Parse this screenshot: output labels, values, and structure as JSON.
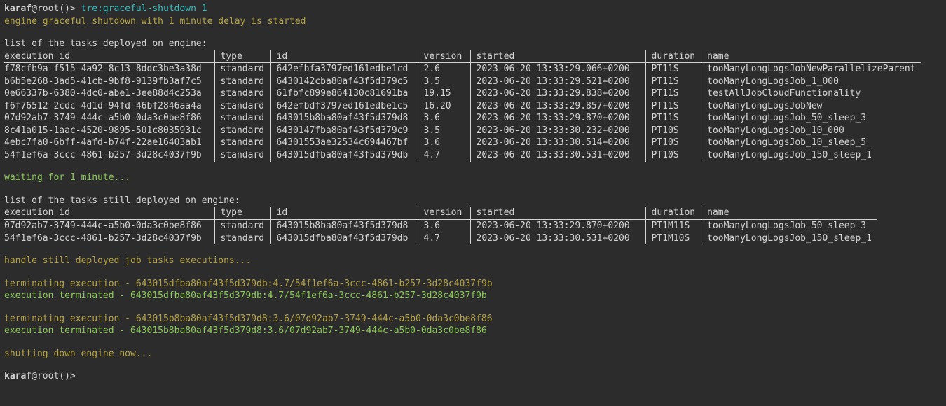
{
  "prompt": {
    "user": "karaf",
    "at": "@",
    "host": "root",
    "tail": "()>"
  },
  "command": {
    "text": "tre:graceful-shutdown",
    "arg": "1"
  },
  "messages": {
    "started": "engine graceful shutdown with 1 minute delay is started",
    "list_one": "list of the tasks deployed on engine:",
    "waiting": "waiting for 1 minute...",
    "list_two": "list of the tasks still deployed on engine:",
    "handle": "handle still deployed job tasks executions...",
    "shutting": "shutting down engine now..."
  },
  "headers": {
    "exec": "execution id",
    "type": "type",
    "id": "id",
    "version": "version",
    "started": "started",
    "duration": "duration",
    "name": "name"
  },
  "table1": [
    {
      "exec": "f78cfb9a-f515-4a92-8c13-8ddc3be3a38d",
      "type": "standard",
      "id": "642efbfa3797ed161edbe1cd",
      "version": "2.6",
      "started": "2023-06-20 13:33:29.066+0200",
      "duration": "PT11S",
      "name": "tooManyLongLogsJobNewParallelizeParent"
    },
    {
      "exec": "b6b5e268-3ad5-41cb-9bf8-9139fb3af7c5",
      "type": "standard",
      "id": "6430142cba80af43f5d379c5",
      "version": "3.5",
      "started": "2023-06-20 13:33:29.521+0200",
      "duration": "PT11S",
      "name": "tooManyLongLogsJob_1_000"
    },
    {
      "exec": "0e66337b-6380-4dc0-abe1-3ee88d4c253a",
      "type": "standard",
      "id": "61fbfc899e864130c81691ba",
      "version": "19.15",
      "started": "2023-06-20 13:33:29.838+0200",
      "duration": "PT11S",
      "name": "testAllJobCloudFunctionality"
    },
    {
      "exec": "f6f76512-2cdc-4d1d-94fd-46bf2846aa4a",
      "type": "standard",
      "id": "642efbdf3797ed161edbe1c5",
      "version": "16.20",
      "started": "2023-06-20 13:33:29.857+0200",
      "duration": "PT11S",
      "name": "tooManyLongLogsJobNew"
    },
    {
      "exec": "07d92ab7-3749-444c-a5b0-0da3c0be8f86",
      "type": "standard",
      "id": "643015b8ba80af43f5d379d8",
      "version": "3.6",
      "started": "2023-06-20 13:33:29.870+0200",
      "duration": "PT11S",
      "name": "tooManyLongLogsJob_50_sleep_3"
    },
    {
      "exec": "8c41a015-1aac-4520-9895-501c8035931c",
      "type": "standard",
      "id": "6430147fba80af43f5d379c9",
      "version": "3.5",
      "started": "2023-06-20 13:33:30.232+0200",
      "duration": "PT10S",
      "name": "tooManyLongLogsJob_10_000"
    },
    {
      "exec": "4ebc7fa0-6bff-4afd-b74f-22ae16403ab1",
      "type": "standard",
      "id": "64301553ae32534c694467bf",
      "version": "3.6",
      "started": "2023-06-20 13:33:30.514+0200",
      "duration": "PT10S",
      "name": "tooManyLongLogsJob_10_sleep_5"
    },
    {
      "exec": "54f1ef6a-3ccc-4861-b257-3d28c4037f9b",
      "type": "standard",
      "id": "643015dfba80af43f5d379db",
      "version": "4.7",
      "started": "2023-06-20 13:33:30.531+0200",
      "duration": "PT10S",
      "name": "tooManyLongLogsJob_150_sleep_1"
    }
  ],
  "table2": [
    {
      "exec": "07d92ab7-3749-444c-a5b0-0da3c0be8f86",
      "type": "standard",
      "id": "643015b8ba80af43f5d379d8",
      "version": "3.6",
      "started": "2023-06-20 13:33:29.870+0200",
      "duration": "PT1M11S",
      "name": "tooManyLongLogsJob_50_sleep_3"
    },
    {
      "exec": "54f1ef6a-3ccc-4861-b257-3d28c4037f9b",
      "type": "standard",
      "id": "643015dfba80af43f5d379db",
      "version": "4.7",
      "started": "2023-06-20 13:33:30.531+0200",
      "duration": "PT1M10S",
      "name": "tooManyLongLogsJob_150_sleep_1"
    }
  ],
  "terminations": [
    {
      "terminating": "terminating execution - 643015dfba80af43f5d379db:4.7/54f1ef6a-3ccc-4861-b257-3d28c4037f9b",
      "terminated": " execution terminated - 643015dfba80af43f5d379db:4.7/54f1ef6a-3ccc-4861-b257-3d28c4037f9b"
    },
    {
      "terminating": "terminating execution - 643015b8ba80af43f5d379d8:3.6/07d92ab7-3749-444c-a5b0-0da3c0be8f86",
      "terminated": " execution terminated - 643015b8ba80af43f5d379d8:3.6/07d92ab7-3749-444c-a5b0-0da3c0be8f86"
    }
  ]
}
